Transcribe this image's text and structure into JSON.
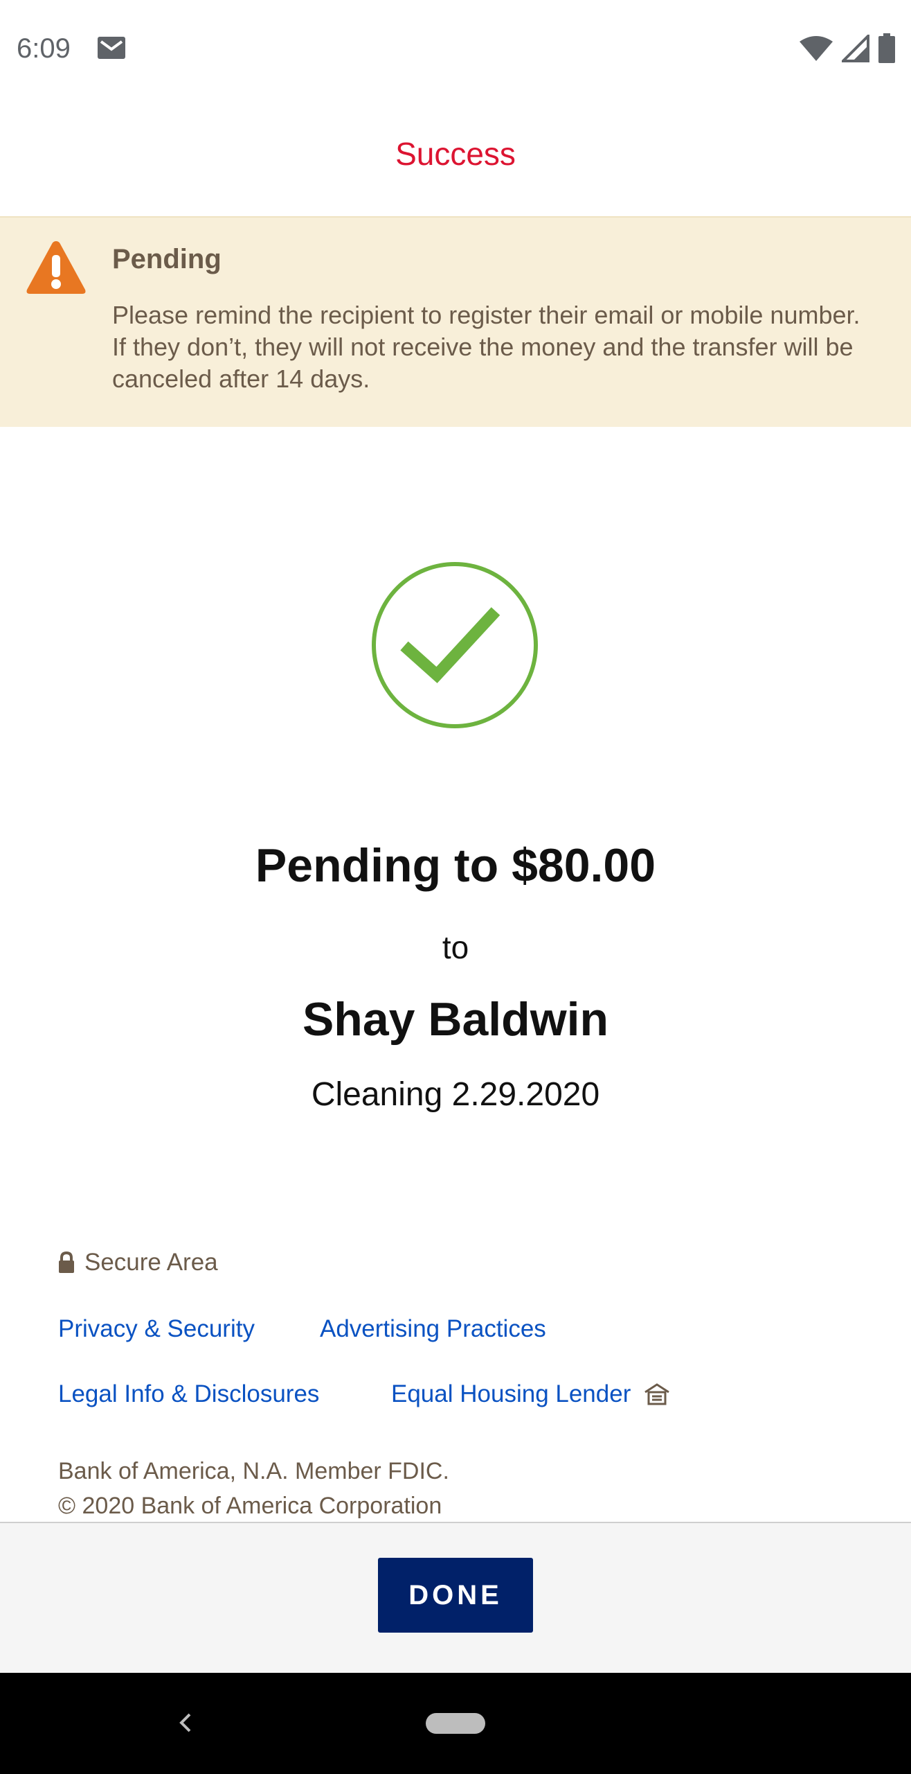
{
  "status_bar": {
    "time": "6:09",
    "icons": [
      "mail-icon",
      "wifi-icon",
      "signal-icon",
      "battery-icon"
    ]
  },
  "header": {
    "title": "Success"
  },
  "banner": {
    "icon": "warning-icon",
    "title": "Pending",
    "message": "Please remind the recipient to register their email or mobile number. If they don’t, they will not receive the money and the transfer will be canceled after 14 days."
  },
  "confirmation": {
    "icon": "check-circle-icon",
    "amount_line": "Pending to $80.00",
    "to_word": "to",
    "recipient": "Shay Baldwin",
    "memo": "Cleaning 2.29.2020"
  },
  "footer": {
    "secure_area": "Secure Area",
    "links": {
      "privacy": "Privacy & Security",
      "advertising": "Advertising Practices",
      "legal": "Legal Info & Disclosures",
      "equal_housing": "Equal Housing Lender"
    },
    "copyright_line1": "Bank of America, N.A. Member FDIC.",
    "copyright_line2": "© 2020 Bank of America Corporation"
  },
  "actions": {
    "done_label": "DONE"
  },
  "colors": {
    "header_red": "#dc1431",
    "banner_bg": "#f8efd9",
    "warning_orange": "#e87722",
    "check_green": "#6db33f",
    "link_blue": "#0a52c2",
    "done_navy": "#012169"
  }
}
